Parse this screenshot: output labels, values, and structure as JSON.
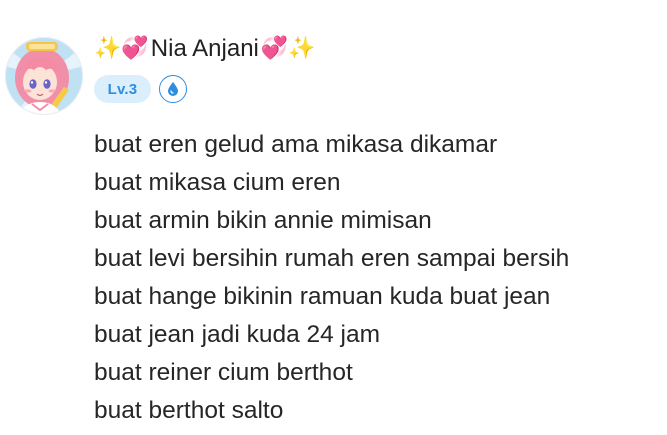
{
  "post": {
    "author": {
      "name_prefix_emoji": "✨💞",
      "name": "Nia Anjani",
      "name_suffix_emoji": "💞✨",
      "level": "Lv.3",
      "avatar_icon": "anime-girl-avatar-icon",
      "role_icon": "droplet-badge-icon"
    },
    "lines": [
      "buat eren gelud ama mikasa dikamar",
      "buat mikasa cium eren",
      "buat armin bikin annie mimisan",
      "buat levi bersihin rumah eren sampai bersih",
      "buat hange bikinin ramuan kuda buat jean",
      "buat jean jadi kuda 24 jam",
      "buat reiner cium berthot",
      "buat berthot salto"
    ]
  },
  "colors": {
    "level_pill_bg": "#dbeefb",
    "level_pill_text": "#2f8de0",
    "text": "#262626"
  }
}
